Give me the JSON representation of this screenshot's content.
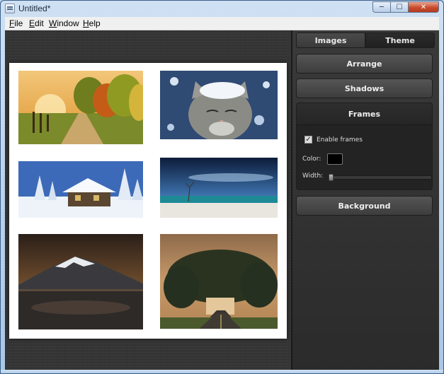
{
  "window": {
    "title": "Untitled*",
    "controls": {
      "minimize_icon": "minimize-icon",
      "maximize_icon": "maximize-icon",
      "close_icon": "close-icon"
    }
  },
  "menubar": {
    "items": [
      {
        "label": "File",
        "mnemonic": "F"
      },
      {
        "label": "Edit",
        "mnemonic": "E"
      },
      {
        "label": "Window",
        "mnemonic": "W"
      },
      {
        "label": "Help",
        "mnemonic": "H"
      }
    ]
  },
  "canvas": {
    "photos": [
      {
        "subject": "autumn country road at sunrise"
      },
      {
        "subject": "snow-covered cat"
      },
      {
        "subject": "snowy cabin among pine trees"
      },
      {
        "subject": "beach under dramatic blue sky"
      },
      {
        "subject": "snow-capped mountain over lake"
      },
      {
        "subject": "tree tunnel over road at dusk"
      }
    ]
  },
  "panel": {
    "tabs": [
      {
        "label": "Images",
        "selected": false
      },
      {
        "label": "Theme",
        "selected": true
      }
    ],
    "sections": {
      "arrange": "Arrange",
      "shadows": "Shadows",
      "frames": "Frames",
      "background": "Background"
    },
    "frames": {
      "enable_label": "Enable frames",
      "enable_checked": true,
      "color_label": "Color:",
      "color_value": "#000000",
      "width_label": "Width:",
      "width_fraction": 0.0
    }
  },
  "colors": {
    "panel_bg": "#2d2d2d",
    "accent_text": "#eeeeee"
  }
}
